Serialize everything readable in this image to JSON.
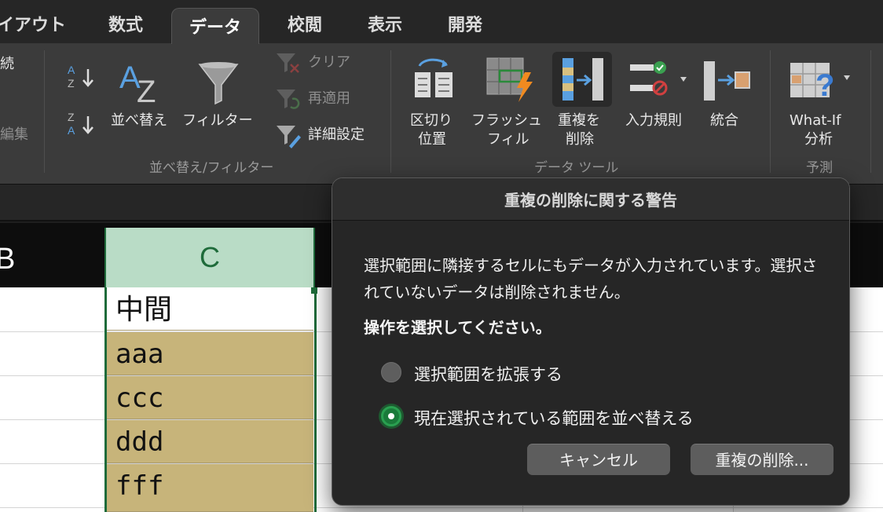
{
  "tabs": [
    {
      "label": "イアウト"
    },
    {
      "label": "数式"
    },
    {
      "label": "データ"
    },
    {
      "label": "校閲"
    },
    {
      "label": "表示"
    },
    {
      "label": "開発"
    }
  ],
  "ribbon": {
    "partial_left": [
      "続",
      "編集"
    ],
    "sort_filter": {
      "sort": "並べ替え",
      "filter": "フィルター",
      "clear": "クリア",
      "reapply": "再適用",
      "advanced": "詳細設定",
      "group_label": "並べ替え/フィルター"
    },
    "data_tools": {
      "text_to_columns": [
        "区切り",
        "位置"
      ],
      "flash_fill": [
        "フラッシュ",
        "フィル"
      ],
      "remove_duplicates": [
        "重複を",
        "削除"
      ],
      "validation": "入力規則",
      "consolidate": "統合",
      "group_label": "データ ツール"
    },
    "forecast": {
      "what_if": [
        "What-If",
        "分析"
      ],
      "group_label": "予測"
    }
  },
  "sheet": {
    "col_b": "B",
    "col_c": "C",
    "cells": [
      "中間",
      "aaa",
      "ccc",
      "ddd",
      "fff"
    ]
  },
  "dialog": {
    "title": "重複の削除に関する警告",
    "message": "選択範囲に隣接するセルにもデータが入力されています。選択されていないデータは削除されません。",
    "prompt": "操作を選択してください。",
    "options": [
      {
        "label": "選択範囲を拡張する",
        "selected": false
      },
      {
        "label": "現在選択されている範囲を並べ替える",
        "selected": true
      }
    ],
    "cancel": "キャンセル",
    "confirm": "重複の削除..."
  },
  "colors": {
    "dup_fill": "#c7b47a",
    "selection": "#1e6b3a",
    "radio_on": "#1a7a3a"
  }
}
